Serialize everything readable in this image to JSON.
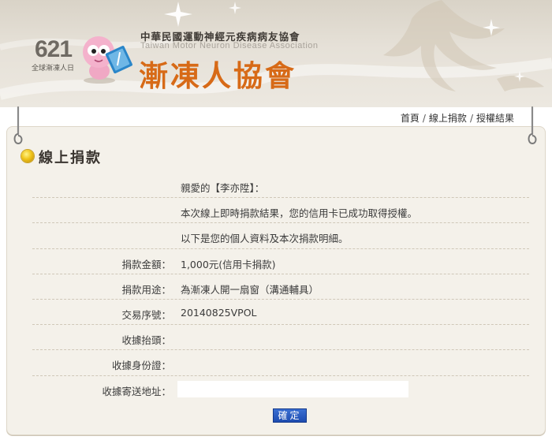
{
  "header": {
    "day_number": "621",
    "day_caption": "全球漸凍人日",
    "org_full_name": "中華民國運動神經元疾病病友協會",
    "org_english_name": "Taiwan Motor Neuron Disease Association",
    "org_short_name": "漸凍人協會"
  },
  "breadcrumb": {
    "items": [
      "首頁",
      "線上捐款",
      "授權結果"
    ],
    "separator": "/"
  },
  "section": {
    "title": "線上捐款"
  },
  "messages": {
    "greeting": "親愛的【李亦陞】：",
    "result_text": "本次線上即時捐款結果，您的信用卡已成功取得授權。",
    "details_intro": "以下是您的個人資料及本次捐款明細。"
  },
  "fields": {
    "amount_label": "捐款金額：",
    "amount_value": "1,000元(信用卡捐款)",
    "purpose_label": "捐款用途：",
    "purpose_value": "為漸凍人開一扇窗（溝通輔具）",
    "transaction_label": "交易序號：",
    "transaction_value": "20140825VPOL",
    "receipt_title_label": "收據抬頭：",
    "receipt_title_value": "",
    "receipt_id_label": "收據身份證：",
    "receipt_id_value": "",
    "receipt_address_label": "收據寄送地址：",
    "receipt_address_value": ""
  },
  "actions": {
    "confirm_label": "確定"
  },
  "colors": {
    "brand_orange": "#d76a17",
    "panel_bg": "#f4f1ea",
    "button_blue": "#1d4cb0"
  },
  "icons": {
    "section_bullet": "yellow-dot-icon",
    "hook": "paperclip-hook-icon",
    "mascot": "mascot-illustration"
  }
}
